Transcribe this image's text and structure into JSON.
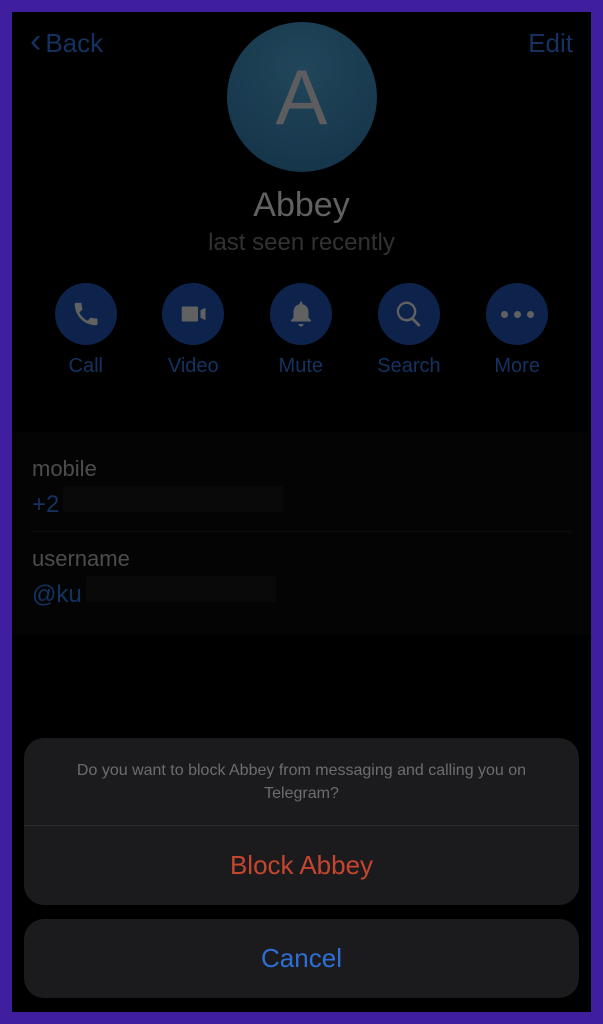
{
  "nav": {
    "back_label": "Back",
    "edit_label": "Edit"
  },
  "profile": {
    "initial": "A",
    "name": "Abbey",
    "status": "last seen recently"
  },
  "actions": {
    "call": "Call",
    "video": "Video",
    "mute": "Mute",
    "search": "Search",
    "more": "More"
  },
  "details": {
    "mobile_label": "mobile",
    "mobile_value": "+2",
    "username_label": "username",
    "username_value": "@ku"
  },
  "sheet": {
    "message": "Do you want to block Abbey from messaging and calling you on Telegram?",
    "block_label": "Block Abbey",
    "cancel_label": "Cancel"
  },
  "colors": {
    "accent": "#2e6fd6",
    "destructive": "#c6452e",
    "frame": "#3f1f9e"
  }
}
